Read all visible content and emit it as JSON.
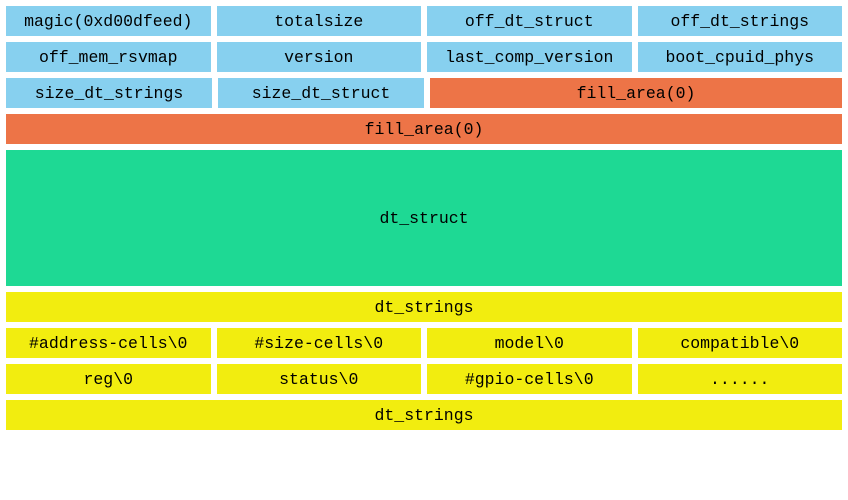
{
  "colors": {
    "blue": "#87d0ef",
    "orange": "#ed7447",
    "green": "#1ed994",
    "yellow": "#f2ed0f"
  },
  "rows": {
    "r1": [
      "magic(0xd00dfeed)",
      "totalsize",
      "off_dt_struct",
      "off_dt_strings"
    ],
    "r2": [
      "off_mem_rsvmap",
      "version",
      "last_comp_version",
      "boot_cpuid_phys"
    ],
    "r3": {
      "a": "size_dt_strings",
      "b": "size_dt_struct",
      "c": "fill_area(0)"
    },
    "r4": "fill_area(0)",
    "r5": "dt_struct",
    "r6": "dt_strings",
    "r7": [
      "#address-cells\\0",
      "#size-cells\\0",
      "model\\0",
      "compatible\\0"
    ],
    "r8": [
      "reg\\0",
      "status\\0",
      "#gpio-cells\\0",
      "......"
    ],
    "r9": "dt_strings"
  }
}
